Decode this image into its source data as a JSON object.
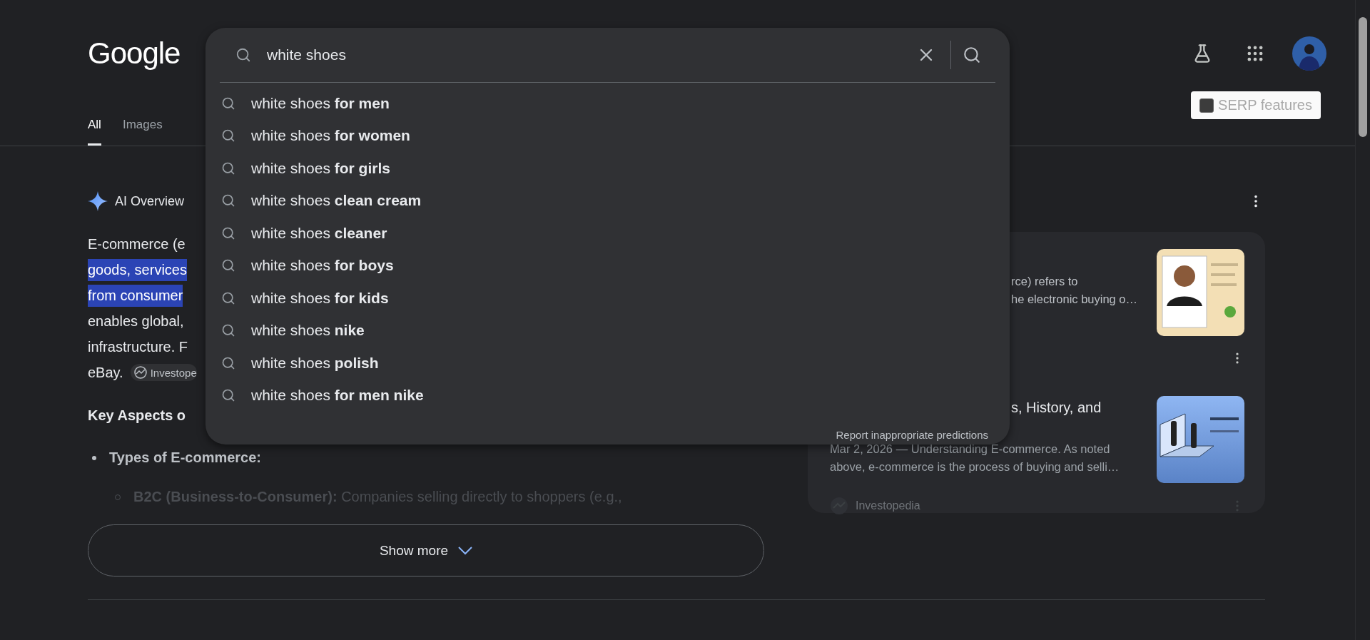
{
  "logo": "Google",
  "search": {
    "value": "white shoes",
    "suggestions": [
      {
        "prefix": "white shoes",
        "completion": "for men"
      },
      {
        "prefix": "white shoes",
        "completion": "for women"
      },
      {
        "prefix": "white shoes",
        "completion": "for girls"
      },
      {
        "prefix": "white shoes",
        "completion": "clean cream"
      },
      {
        "prefix": "white shoes",
        "completion": "cleaner"
      },
      {
        "prefix": "white shoes",
        "completion": "for boys"
      },
      {
        "prefix": "white shoes",
        "completion": "for kids"
      },
      {
        "prefix": "white shoes",
        "completion": "nike"
      },
      {
        "prefix": "white shoes",
        "completion": "polish"
      },
      {
        "prefix": "white shoes",
        "completion": "for men nike"
      }
    ],
    "report_link": "Report inappropriate predictions"
  },
  "tabs": [
    {
      "label": "All",
      "selected": true
    },
    {
      "label": "Images",
      "selected": false
    }
  ],
  "serp_toggle": {
    "label": "SERP features",
    "checked": false
  },
  "ai_overview": {
    "title": "AI Overview",
    "lines": [
      {
        "text": "E-commerce (e",
        "highlighted": false
      },
      {
        "text": "goods, services",
        "highlighted": true
      },
      {
        "text": "from consumer",
        "highlighted": true
      },
      {
        "text": "enables global,",
        "highlighted": false
      },
      {
        "text": "infrastructure. F",
        "highlighted": false
      },
      {
        "text": "eBay.",
        "highlighted": false,
        "source_chip": "Investope"
      }
    ],
    "heading": "Key Aspects o",
    "bullets": [
      {
        "text": "Types of E-commerce:",
        "children": [
          {
            "term": "B2C (Business-to-Consumer):",
            "text": "Companies selling directly to shoppers (e.g.,"
          }
        ]
      }
    ],
    "show_more": "Show more"
  },
  "sources": [
    {
      "snippet": [
        "rce) refers to",
        "he electronic buying o…"
      ]
    },
    {
      "title": "s, History, and",
      "snippet": [
        "Mar 2, 2026 — Understanding E-commerce. As noted",
        "above, e-commerce is the process of buying and selli…"
      ],
      "source": "Investopedia"
    }
  ]
}
